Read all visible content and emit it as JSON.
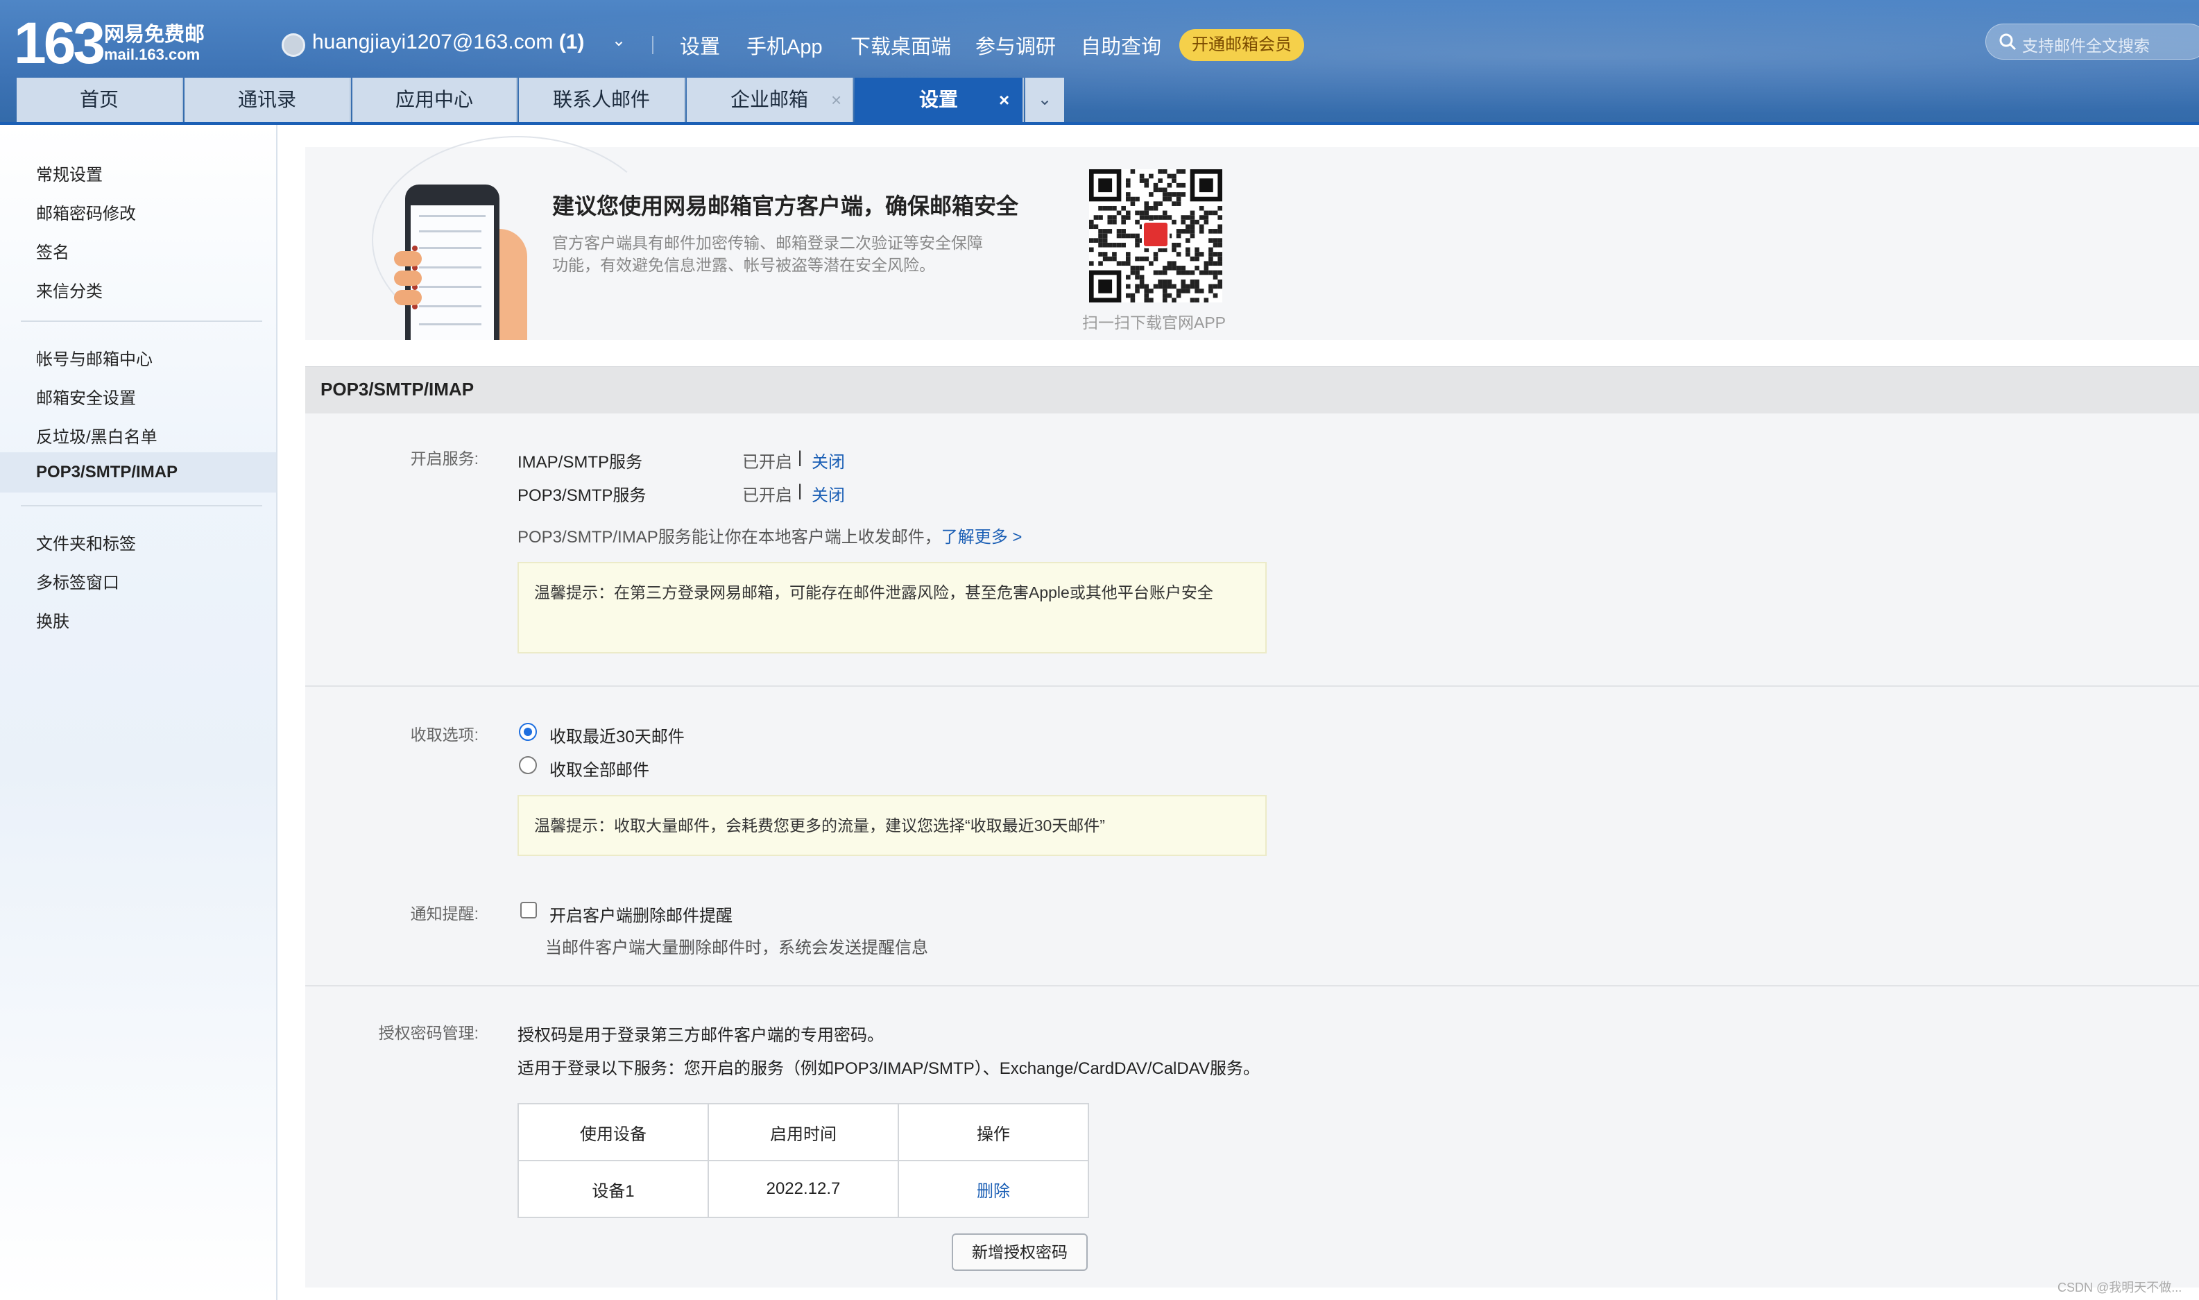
{
  "header": {
    "logo_number": "163",
    "logo_text": "网易免费邮",
    "logo_domain": "mail.163.com",
    "account": "huangjiayi1207@163.com",
    "account_count": "(1)",
    "nav": [
      "设置",
      "手机App",
      "下载桌面端",
      "参与调研",
      "自助查询"
    ],
    "vip_button": "开通邮箱会员",
    "search_placeholder": "支持邮件全文搜索",
    "search_icon": "search-icon"
  },
  "tabs": [
    {
      "label": "首页"
    },
    {
      "label": "通讯录"
    },
    {
      "label": "应用中心"
    },
    {
      "label": "联系人邮件"
    },
    {
      "label": "企业邮箱",
      "closable": true
    },
    {
      "label": "设置",
      "closable": true,
      "active": true
    }
  ],
  "tab_close": "×",
  "tab_more": "⌄",
  "sidebar": {
    "group1": [
      "常规设置",
      "邮箱密码修改",
      "签名",
      "来信分类"
    ],
    "group2": [
      "帐号与邮箱中心",
      "邮箱安全设置",
      "反垃圾/黑白名单",
      "POP3/SMTP/IMAP"
    ],
    "group3": [
      "文件夹和标签",
      "多标签窗口",
      "换肤"
    ],
    "active": "POP3/SMTP/IMAP"
  },
  "banner": {
    "title": "建议您使用网易邮箱官方客户端，确保邮箱安全",
    "desc": "官方客户端具有邮件加密传输、邮箱登录二次验证等安全保障功能，有效避免信息泄露、帐号被盗等潜在安全风险。",
    "qr_caption": "扫一扫下载官网APP"
  },
  "section_title": "POP3/SMTP/IMAP",
  "services": {
    "label": "开启服务:",
    "rows": [
      {
        "name": "IMAP/SMTP服务",
        "status": "已开启",
        "sep": "|",
        "action": "关闭"
      },
      {
        "name": "POP3/SMTP服务",
        "status": "已开启",
        "sep": "|",
        "action": "关闭"
      }
    ],
    "note": "POP3/SMTP/IMAP服务能让你在本地客户端上收发邮件，",
    "learn_more": "了解更多 >",
    "tip": "温馨提示：在第三方登录网易邮箱，可能存在邮件泄露风险，甚至危害Apple或其他平台账户安全"
  },
  "receive": {
    "label": "收取选项:",
    "options": [
      {
        "text": "收取最近30天邮件",
        "selected": true
      },
      {
        "text": "收取全部邮件",
        "selected": false
      }
    ],
    "tip": "温馨提示：收取大量邮件，会耗费您更多的流量，建议您选择“收取最近30天邮件”"
  },
  "notify": {
    "label": "通知提醒:",
    "checkbox": "开启客户端删除邮件提醒",
    "checked": false,
    "desc": "当邮件客户端大量删除邮件时，系统会发送提醒信息"
  },
  "auth": {
    "label": "授权密码管理:",
    "line1": "授权码是用于登录第三方邮件客户端的专用密码。",
    "line2": "适用于登录以下服务：您开启的服务（例如POP3/IMAP/SMTP）、Exchange/CardDAV/CalDAV服务。",
    "columns": [
      "使用设备",
      "启用时间",
      "操作"
    ],
    "rows": [
      {
        "device": "设备1",
        "date": "2022.12.7",
        "action": "删除"
      }
    ],
    "add_button": "新增授权密码"
  },
  "watermark": "CSDN @我明天不做..."
}
